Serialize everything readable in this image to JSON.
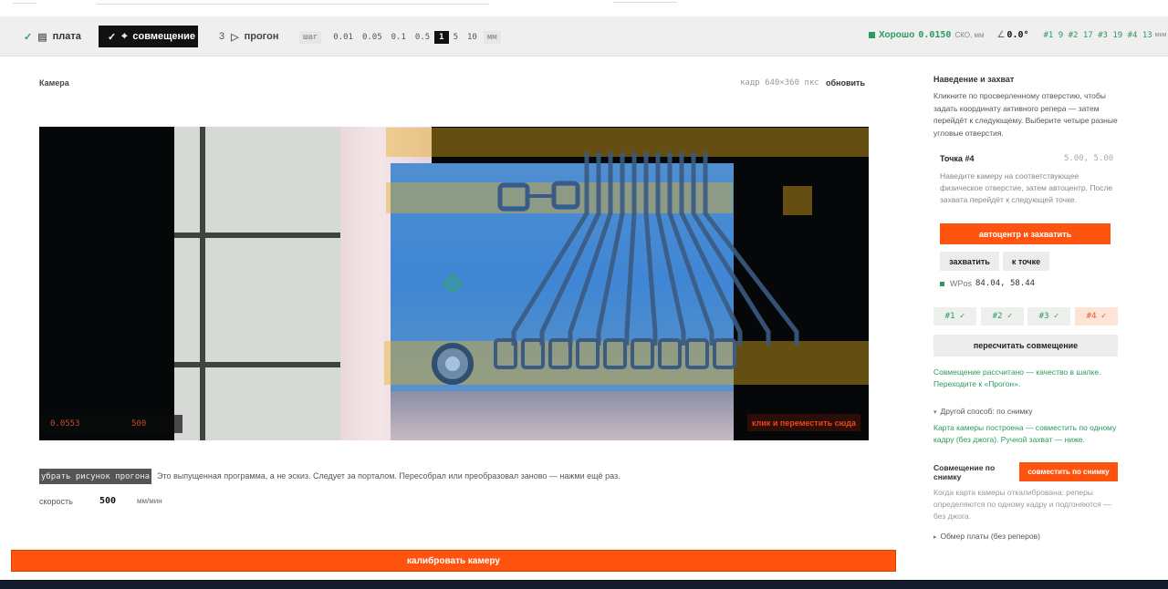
{
  "toolbar": {
    "steps": [
      {
        "label": "плата",
        "done": true
      },
      {
        "label": "совмещение",
        "done": true,
        "active": true
      },
      {
        "number": "3",
        "label": "прогон"
      }
    ],
    "step_size": {
      "label": "шаг",
      "options": [
        "0.01",
        "0.05",
        "0.1",
        "0.5",
        "1",
        "5",
        "10"
      ],
      "selected": "1",
      "unit": "мм"
    },
    "quality": {
      "status": "Хорошо",
      "value": "0.0150",
      "unit": "СКО, мм",
      "angle_symbol": "∠",
      "angle": "0.0°",
      "points": "#1 9 #2 17 #3 19 #4 13",
      "points_unit": "мкм"
    }
  },
  "camera": {
    "title": "Камера",
    "frame_info": "кадр 640×360 пкс",
    "refresh_label": "обновить",
    "overlay_left": "0.0553",
    "overlay_mid": "500",
    "click_move_label": "клик и переместить сюда"
  },
  "controls": {
    "hide_program_label": "убрать рисунок прогона",
    "hint": "Это выпущенная программа, а не эскиз. Следует за порталом. Пересобрал или преобразовал заново — нажми ещё раз.",
    "speed_label": "скорость",
    "speed_value": "500",
    "speed_unit": "мм/мин",
    "calibrate_label": "калибровать камеру"
  },
  "panel": {
    "title": "Наведение и захват",
    "description": "Кликните по просверленному отверстию, чтобы задать координату активного репера — затем перейдёт к следующему. Выберите четыре разные угловые отверстия.",
    "point_title": "Точка #4",
    "point_coords": "5.00, 5.00",
    "point_desc": "Наведите камеру на соответствующее физическое отверстие, затем автоцентр. После захвата перейдёт к следующей точке.",
    "autocenter_label": "автоцентр и захватить",
    "capture_label": "захватить",
    "goto_label": "к точке",
    "wpos_label": "WPos",
    "wpos_value": "84.04, 58.44",
    "fiducials": [
      {
        "label": "#1 ✓",
        "state": "ok"
      },
      {
        "label": "#2 ✓",
        "state": "ok"
      },
      {
        "label": "#3 ✓",
        "state": "ok"
      },
      {
        "label": "#4 ✓",
        "state": "active"
      }
    ],
    "recalc_label": "пересчитать совмещение",
    "result_text": "Совмещение рассчитано — качество в шапке. Переходите к «Прогон».",
    "alt_method": "Другой способ: по снимку",
    "alt_text": "Карта камеры построена — совместить по одному кадру (без джога). Ручной захват — ниже.",
    "snapshot_label": "Совмещение по снимку",
    "snapshot_button": "совместить по снимку",
    "snapshot_desc": "Когда карта камеры откалибрована: реперы определяются по одному кадру и подгоняются — без джога.",
    "measure_label": "Обмер платы (без реперов)"
  },
  "colors": {
    "accent": "#ff5410",
    "ok": "#2a9a5e",
    "trace": "#e8b224"
  }
}
